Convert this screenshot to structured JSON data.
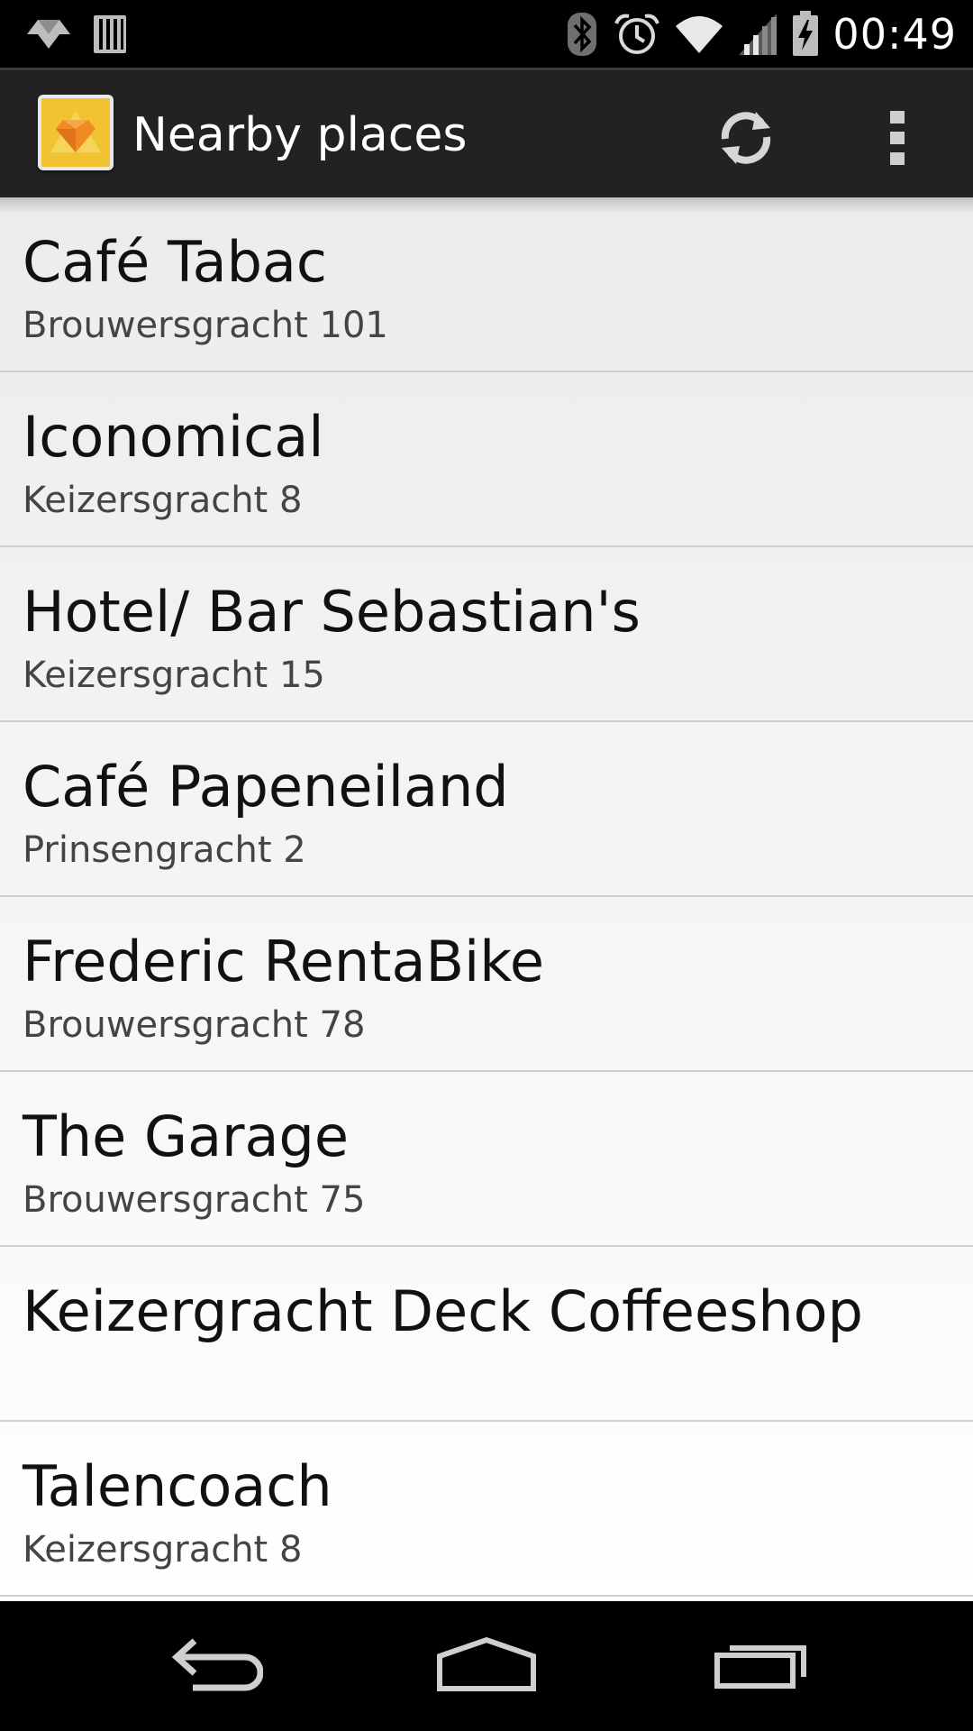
{
  "status_bar": {
    "time": "00:49",
    "icons": [
      "notification-icon",
      "sim-card-icon",
      "bluetooth-icon",
      "alarm-icon",
      "wifi-icon",
      "signal-icon",
      "battery-charging-icon"
    ]
  },
  "action_bar": {
    "app_icon": "app-logo-diamond",
    "title": "Nearby places",
    "actions": [
      "refresh-icon",
      "overflow-menu-icon"
    ]
  },
  "places": [
    {
      "name": "Café Tabac",
      "address": "Brouwersgracht 101"
    },
    {
      "name": "Iconomical",
      "address": "Keizersgracht 8"
    },
    {
      "name": "Hotel/ Bar Sebastian's",
      "address": "Keizersgracht 15"
    },
    {
      "name": "Café Papeneiland",
      "address": "Prinsengracht 2"
    },
    {
      "name": "Frederic RentaBike",
      "address": "Brouwersgracht 78"
    },
    {
      "name": "The Garage",
      "address": "Brouwersgracht 75"
    },
    {
      "name": "Keizergracht Deck Coffeeshop",
      "address": ""
    },
    {
      "name": "Talencoach",
      "address": "Keizersgracht 8"
    }
  ],
  "nav_bar": {
    "buttons": [
      "back-icon",
      "home-icon",
      "recent-apps-icon"
    ]
  },
  "colors": {
    "status_bar_bg": "#000000",
    "action_bar_bg": "#222222",
    "app_icon_yellow": "#f1c232",
    "app_icon_orange": "#f08a24",
    "list_bg": "#f2f2f2",
    "divider": "#cfcfcf"
  }
}
